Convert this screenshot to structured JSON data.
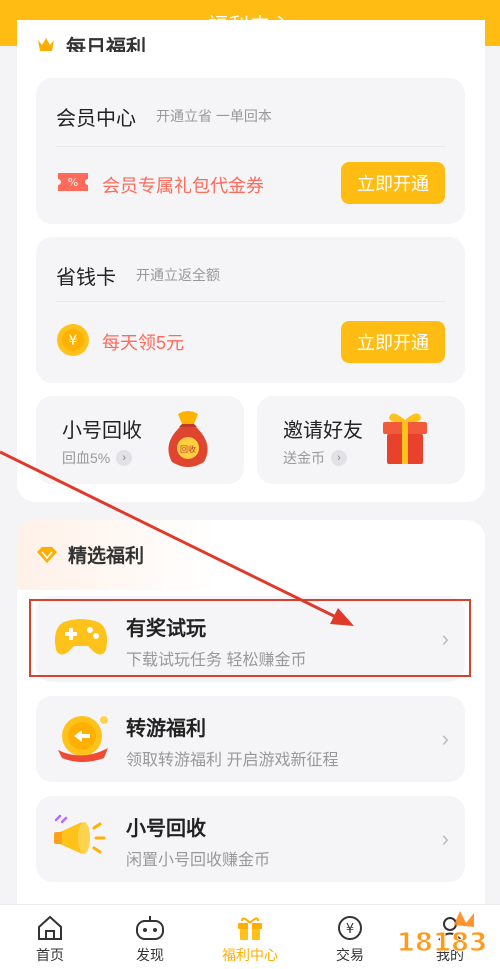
{
  "app": {
    "title": "福利中心"
  },
  "daily_section": {
    "title": "每日福利"
  },
  "vip": {
    "title": "会员中心",
    "subtitle": "开通立省 一单回本",
    "perk": "会员专属礼包代金券",
    "perk_icon": "coupon-icon",
    "button": "立即开通"
  },
  "savecard": {
    "title": "省钱卡",
    "subtitle": "开通立返全额",
    "perk": "每天领5元",
    "perk_icon": "coin-icon",
    "button": "立即开通"
  },
  "mini_cards": [
    {
      "title": "小号回收",
      "subtitle": "回血5%",
      "icon": "money-bag-icon",
      "bag_text": "回收"
    },
    {
      "title": "邀请好友",
      "subtitle": "送金币",
      "icon": "gift-box-icon"
    }
  ],
  "featured": {
    "title": "精选福利",
    "items": [
      {
        "title": "有奖试玩",
        "subtitle": "下载试玩任务 轻松赚金币",
        "icon": "gamepad-icon"
      },
      {
        "title": "转游福利",
        "subtitle": "领取转游福利 开启游戏新征程",
        "icon": "coin-badge-icon"
      },
      {
        "title": "小号回收",
        "subtitle": "闲置小号回收赚金币",
        "icon": "megaphone-icon"
      }
    ]
  },
  "nav": {
    "items": [
      {
        "label": "首页",
        "icon": "home-icon"
      },
      {
        "label": "发现",
        "icon": "discover-icon"
      },
      {
        "label": "福利中心",
        "icon": "gift-icon",
        "active": true
      },
      {
        "label": "交易",
        "icon": "yen-icon"
      },
      {
        "label": "我的",
        "icon": "profile-icon"
      }
    ]
  },
  "watermark": {
    "text": "18183"
  },
  "colors": {
    "brand": "#ffbd14",
    "perk_text": "#ff6a5a",
    "annotation": "#d9412f",
    "active_nav": "#ffae00"
  }
}
